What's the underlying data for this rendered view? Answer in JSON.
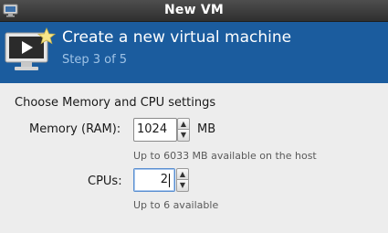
{
  "window": {
    "title": "New VM"
  },
  "banner": {
    "heading": "Create a new virtual machine",
    "step": "Step 3 of 5"
  },
  "form": {
    "section_title": "Choose Memory and CPU settings",
    "memory": {
      "label": "Memory (RAM):",
      "value": "1024",
      "unit": "MB",
      "hint": "Up to 6033 MB available on the host"
    },
    "cpus": {
      "label": "CPUs:",
      "value": "2",
      "hint": "Up to 6 available"
    }
  },
  "icons": {
    "window": "monitor-icon",
    "banner": "new-vm-monitor-star-icon",
    "spin_up": "arrow-up-icon",
    "spin_down": "arrow-down-icon"
  },
  "colors": {
    "banner_bg": "#1b5c9e",
    "banner_step_text": "#9fc3e6",
    "titlebar_bg": "#3a3a3a"
  }
}
